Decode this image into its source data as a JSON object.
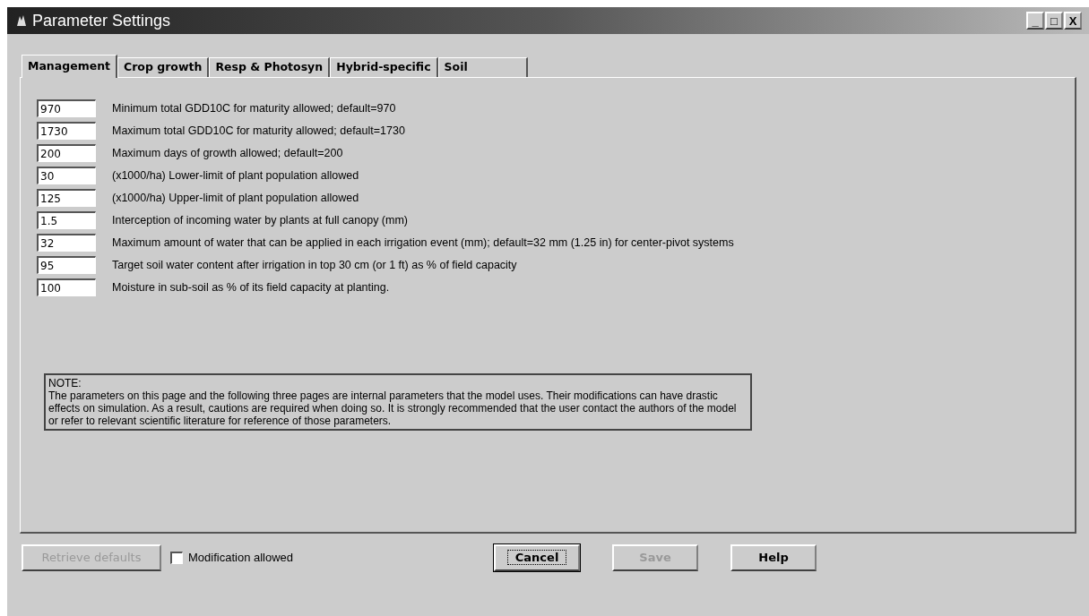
{
  "window": {
    "title": "Parameter Settings",
    "controls": [
      "_",
      "□",
      "X"
    ]
  },
  "tabs": [
    {
      "label": "Management",
      "selected": true
    },
    {
      "label": "Crop growth",
      "selected": false
    },
    {
      "label": "Resp & Photosyn",
      "selected": false
    },
    {
      "label": "Hybrid-specific",
      "selected": false
    },
    {
      "label": "Soil",
      "selected": false
    }
  ],
  "parameters": [
    {
      "value": "970",
      "label": "Minimum total GDD10C for maturity allowed; default=970"
    },
    {
      "value": "1730",
      "label": "Maximum total GDD10C for maturity allowed; default=1730"
    },
    {
      "value": "200",
      "label": "Maximum days of growth allowed; default=200"
    },
    {
      "value": "30",
      "label": "(x1000/ha) Lower-limit of plant population allowed"
    },
    {
      "value": "125",
      "label": "(x1000/ha) Upper-limit of plant population allowed"
    },
    {
      "value": "1.5",
      "label": "Interception of incoming water by plants at full canopy (mm)"
    },
    {
      "value": "32",
      "label": "Maximum amount of water that can be applied in each irrigation event (mm); default=32 mm (1.25 in) for center-pivot systems"
    },
    {
      "value": "95",
      "label": "Target soil water content after irrigation in top 30 cm (or 1 ft) as % of field capacity"
    },
    {
      "value": "100",
      "label": "Moisture in sub-soil as % of its field capacity at planting."
    }
  ],
  "note": {
    "title": "NOTE:",
    "text": "The parameters on this page and the following three pages are internal parameters that the model uses. Their modifications can have drastic effects on simulation. As a result, cautions are required when doing so. It is strongly recommended that the user contact the authors of the model or refer to relevant scientific literature for reference of those parameters."
  },
  "retrieve_button": {
    "label": "Retrieve defaults",
    "disabled": true
  },
  "modification_checkbox": {
    "label": "Modification allowed",
    "checked": false
  },
  "buttons": [
    {
      "label": "Cancel",
      "disabled": false,
      "focused": true
    },
    {
      "label": "Save",
      "disabled": true,
      "focused": false
    },
    {
      "label": "Help",
      "disabled": false,
      "focused": false
    }
  ]
}
